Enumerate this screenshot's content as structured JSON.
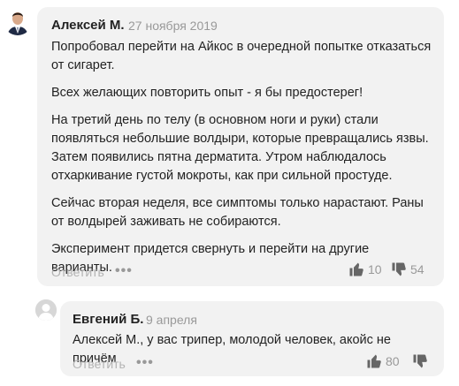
{
  "comment": {
    "author": "Алексей М.",
    "date": "27 ноября 2019",
    "paragraphs": [
      "Попробовал перейти на Айкос в очередной попытке отказаться от сигарет.",
      "Всех желающих повторить опыт - я бы предостерег!",
      "На третий день по телу (в основном ноги и руки) стали появляться небольшие волдыри, которые превращались язвы. Затем появились пятна дерматита. Утром наблюдалось отхаркивание густой мокроты, как при сильной простуде.",
      "Сейчас вторая неделя, все симптомы только нарастают. Раны от волдырей заживать не собираются.",
      "Эксперимент придется свернуть и перейти на другие варианты."
    ],
    "reply_label": "Ответить",
    "more_label": "•••",
    "likes": "10",
    "dislikes": "54"
  },
  "reply": {
    "author": "Евгений Б.",
    "date": "9 апреля",
    "text": "Алексей М., у вас трипер, молодой человек, акойс не причём",
    "reply_label": "Ответить",
    "more_label": "•••",
    "likes": "80"
  },
  "icons": {
    "avatar": "person-avatar-icon",
    "thumbs_up": "thumbs-up-icon",
    "thumbs_down": "thumbs-down-icon",
    "default_avatar": "default-user-icon"
  },
  "colors": {
    "bubble": "#f2f2f2",
    "muted": "#999999",
    "icon": "#666666"
  }
}
